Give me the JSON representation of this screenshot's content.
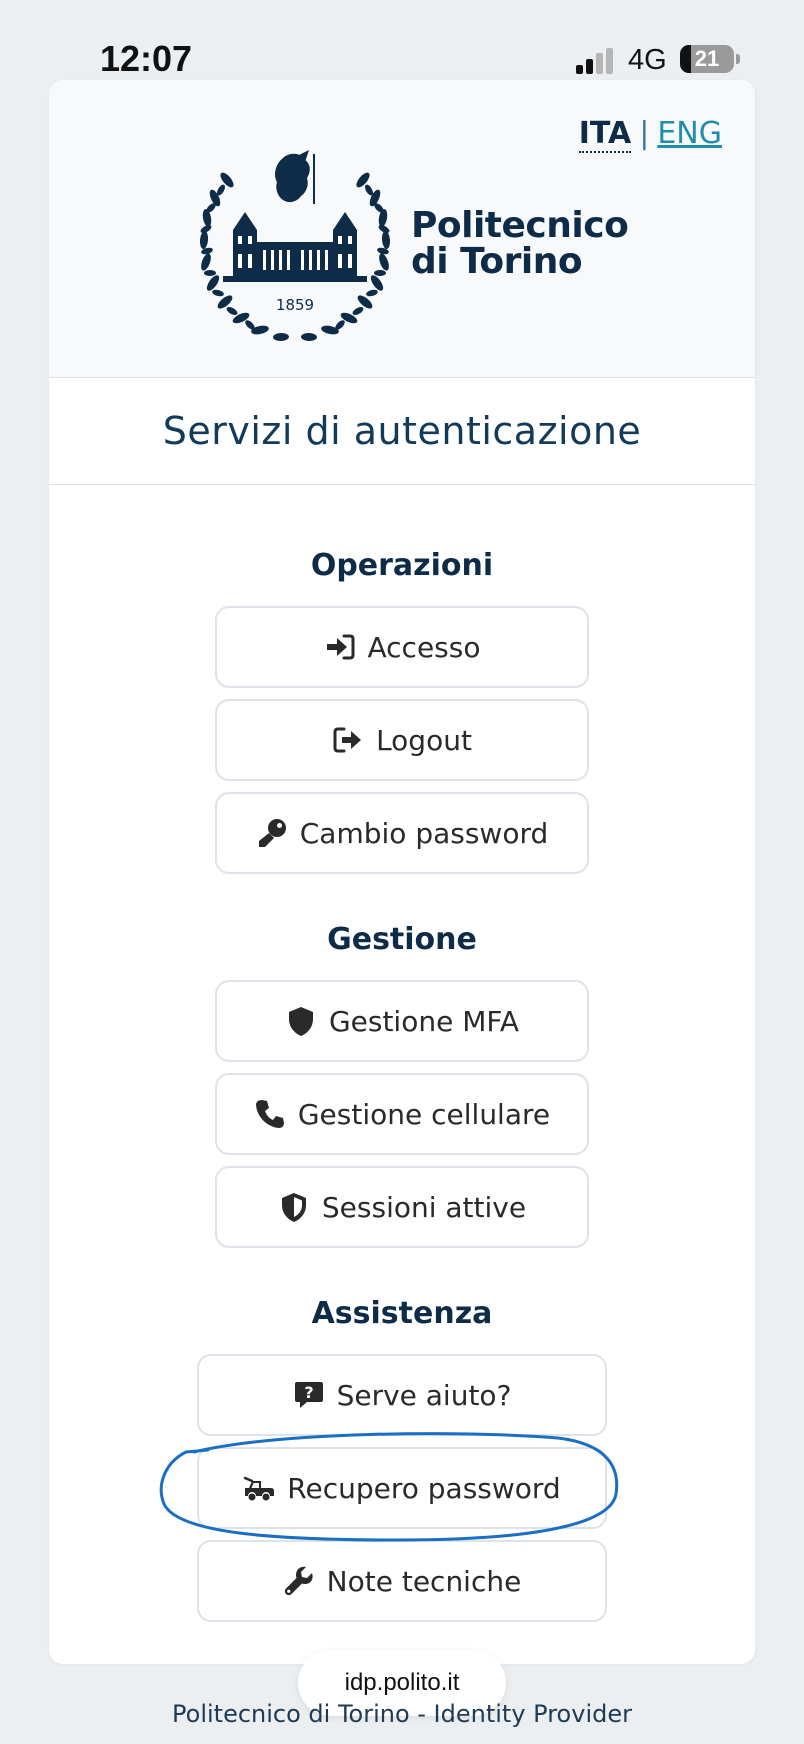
{
  "status_bar": {
    "time": "12:07",
    "network": "4G",
    "battery_level": "21",
    "battery_fraction": 0.21
  },
  "header": {
    "lang_ita": "ITA",
    "lang_sep": "|",
    "lang_eng": "ENG",
    "logo_line1": "Politecnico",
    "logo_line2": "di Torino",
    "logo_year": "1859"
  },
  "page_title": "Servizi di autenticazione",
  "sections": {
    "operazioni": {
      "title": "Operazioni",
      "items": [
        {
          "label": "Accesso",
          "icon": "sign-in-icon"
        },
        {
          "label": "Logout",
          "icon": "sign-out-icon"
        },
        {
          "label": "Cambio password",
          "icon": "key-icon"
        }
      ]
    },
    "gestione": {
      "title": "Gestione",
      "items": [
        {
          "label": "Gestione MFA",
          "icon": "shield-icon"
        },
        {
          "label": "Gestione cellulare",
          "icon": "phone-icon"
        },
        {
          "label": "Sessioni attive",
          "icon": "shield-halved-icon"
        }
      ]
    },
    "assistenza": {
      "title": "Assistenza",
      "items": [
        {
          "label": "Serve aiuto?",
          "icon": "question-bubble-icon"
        },
        {
          "label": "Recupero password",
          "icon": "truck-pickup-icon"
        },
        {
          "label": "Note tecniche",
          "icon": "wrench-icon"
        }
      ]
    }
  },
  "browser": {
    "url": "idp.polito.it"
  },
  "footer": "Politecnico di Torino - Identity Provider",
  "colors": {
    "brand": "#0e2c48",
    "link": "#1e8fa8",
    "annotation": "#1a6fc2",
    "background": "#eceff2"
  }
}
